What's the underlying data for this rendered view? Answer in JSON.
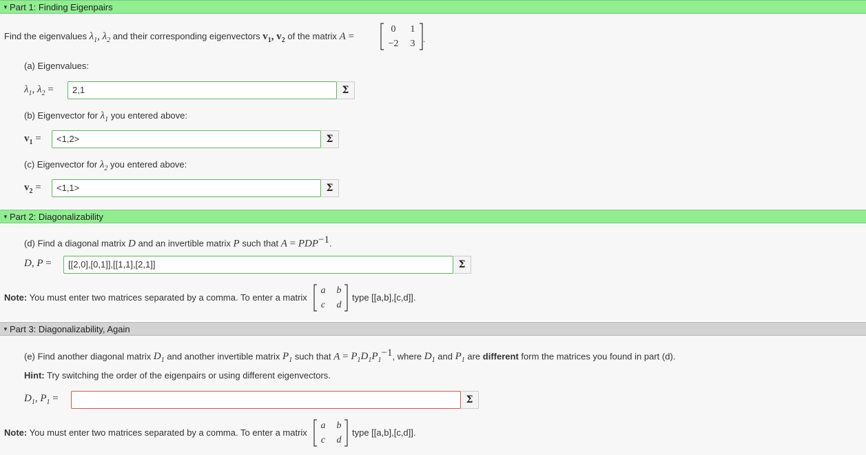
{
  "part1": {
    "header": "Part 1: Finding Eigenpairs",
    "intro_text": "Find the eigenvalues",
    "intro_mid": "and their corresponding eigenvectors",
    "intro_end": "of the matrix",
    "matrix_A": [
      "0",
      "1",
      "−2",
      "3"
    ],
    "a_label": "(a) Eigenvalues:",
    "a_value": "2,1",
    "b_label": "(b) Eigenvector for",
    "b_label_end": "you entered above:",
    "b_value": "<1,2>",
    "c_label": "(c) Eigenvector for",
    "c_label_end": "you entered above:",
    "c_value": "<1,1>"
  },
  "part2": {
    "header": "Part 2: Diagonalizability",
    "d_label": "(d) Find a diagonal matrix",
    "d_mid": "and an invertible matrix",
    "d_mid2": "such that",
    "d_value": "[[2,0],[0,1]],[[1,1],[2,1]]",
    "note_bold": "Note:",
    "note_text": "You must enter two matrices separated by a comma. To enter a matrix",
    "note_end": "type [[a,b],[c,d]].",
    "note_matrix": [
      "a",
      "b",
      "c",
      "d"
    ]
  },
  "part3": {
    "header": "Part 3: Diagonalizability, Again",
    "e_label": "(e) Find another diagonal matrix",
    "e_mid": "and another invertible matrix",
    "e_mid2": "such that",
    "e_where": ", where",
    "e_and": "and",
    "e_are": "are",
    "e_bold": "different",
    "e_end": "form the matrices you found in part (d).",
    "hint_bold": "Hint:",
    "hint_text": "Try switching the order of the eigenpairs or using different eigenvectors.",
    "e_value": "",
    "note_bold": "Note:",
    "note_text": "You must enter two matrices separated by a comma. To enter a matrix",
    "note_end": "type [[a,b],[c,d]].",
    "note_matrix": [
      "a",
      "b",
      "c",
      "d"
    ]
  },
  "sigma_label": "Σ",
  "colors": {
    "header_green": "#90ee90",
    "header_gray": "#d3d3d3",
    "input_ok": "#5cb85c",
    "input_bad": "#d9534f"
  }
}
